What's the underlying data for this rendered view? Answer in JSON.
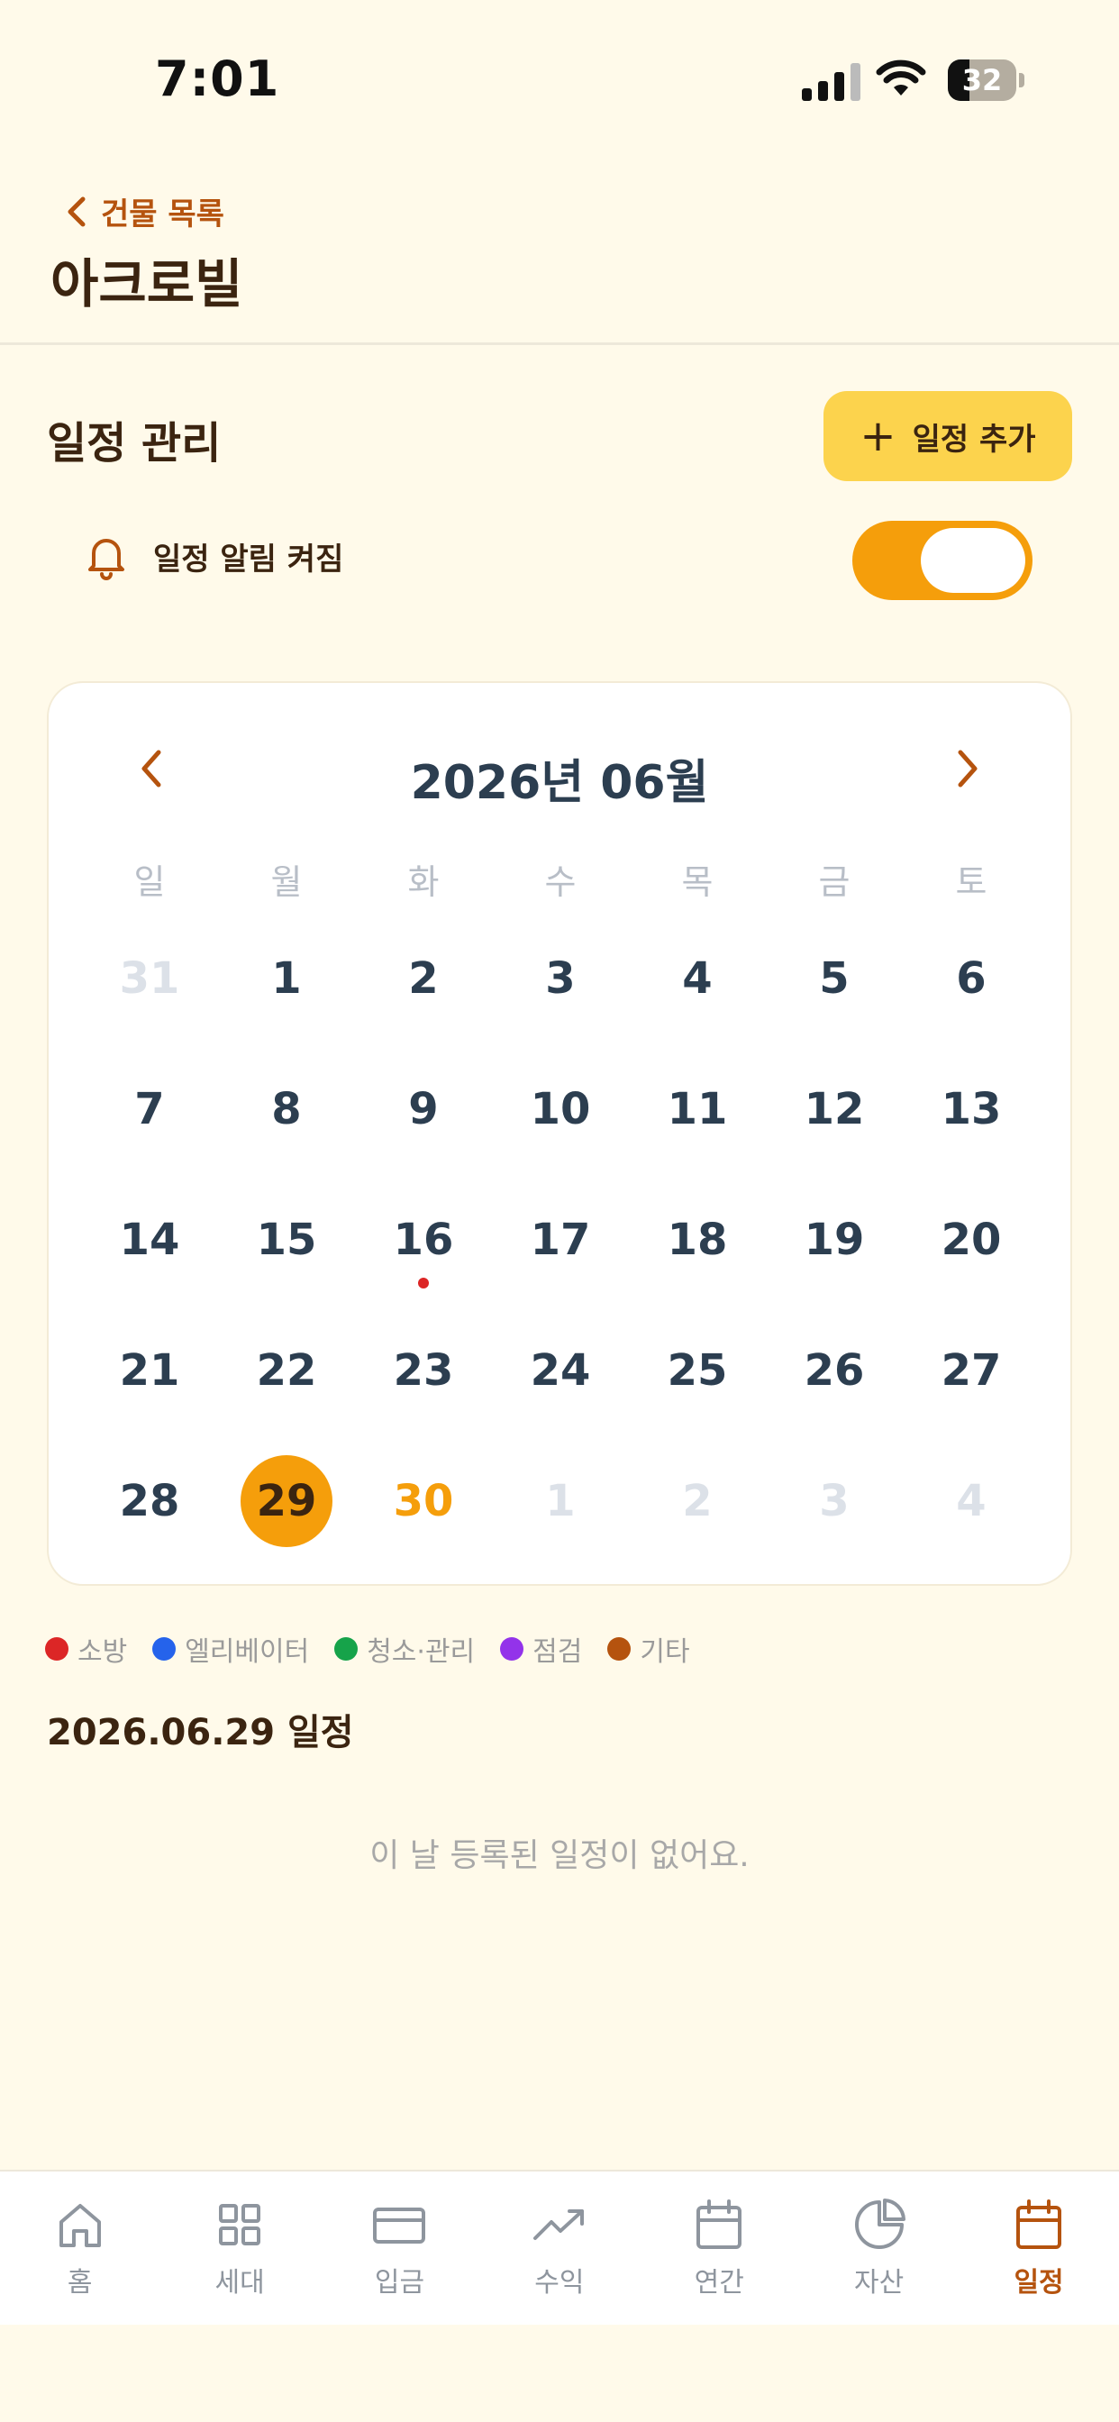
{
  "status_bar": {
    "time": "7:01",
    "battery": "32",
    "battery_level": 0.32
  },
  "header": {
    "back_label": "건물 목록",
    "title": "아크로빌"
  },
  "schedule": {
    "section_title": "일정 관리",
    "add_button_label": "일정 추가",
    "alarm_label": "일정 알림 켜짐",
    "alarm_on": true
  },
  "calendar": {
    "title": "2026년 06월",
    "weekdays": [
      "일",
      "월",
      "화",
      "수",
      "목",
      "금",
      "토"
    ],
    "weeks": [
      [
        {
          "d": "31",
          "other": true
        },
        {
          "d": "1"
        },
        {
          "d": "2"
        },
        {
          "d": "3"
        },
        {
          "d": "4"
        },
        {
          "d": "5"
        },
        {
          "d": "6"
        }
      ],
      [
        {
          "d": "7"
        },
        {
          "d": "8"
        },
        {
          "d": "9"
        },
        {
          "d": "10"
        },
        {
          "d": "11"
        },
        {
          "d": "12"
        },
        {
          "d": "13"
        }
      ],
      [
        {
          "d": "14"
        },
        {
          "d": "15"
        },
        {
          "d": "16",
          "event": true
        },
        {
          "d": "17"
        },
        {
          "d": "18"
        },
        {
          "d": "19"
        },
        {
          "d": "20"
        }
      ],
      [
        {
          "d": "21"
        },
        {
          "d": "22"
        },
        {
          "d": "23"
        },
        {
          "d": "24"
        },
        {
          "d": "25"
        },
        {
          "d": "26"
        },
        {
          "d": "27"
        }
      ],
      [
        {
          "d": "28"
        },
        {
          "d": "29",
          "selected": true
        },
        {
          "d": "30",
          "today": true
        },
        {
          "d": "1",
          "other": true
        },
        {
          "d": "2",
          "other": true
        },
        {
          "d": "3",
          "other": true
        },
        {
          "d": "4",
          "other": true
        }
      ]
    ]
  },
  "legend": [
    {
      "label": "소방",
      "color": "#DC2626"
    },
    {
      "label": "엘리베이터",
      "color": "#2563EB"
    },
    {
      "label": "청소·관리",
      "color": "#16A34A"
    },
    {
      "label": "점검",
      "color": "#9333EA"
    },
    {
      "label": "기타",
      "color": "#B5530E"
    }
  ],
  "selected_date_heading": "2026.06.29 일정",
  "empty_message": "이 날 등록된 일정이 없어요.",
  "tabs": [
    {
      "label": "홈",
      "icon": "home-icon"
    },
    {
      "label": "세대",
      "icon": "grid-icon"
    },
    {
      "label": "입금",
      "icon": "card-icon"
    },
    {
      "label": "수익",
      "icon": "trending-up-icon"
    },
    {
      "label": "연간",
      "icon": "calendar-icon"
    },
    {
      "label": "자산",
      "icon": "pie-chart-icon"
    },
    {
      "label": "일정",
      "icon": "calendar-icon",
      "active": true
    }
  ]
}
